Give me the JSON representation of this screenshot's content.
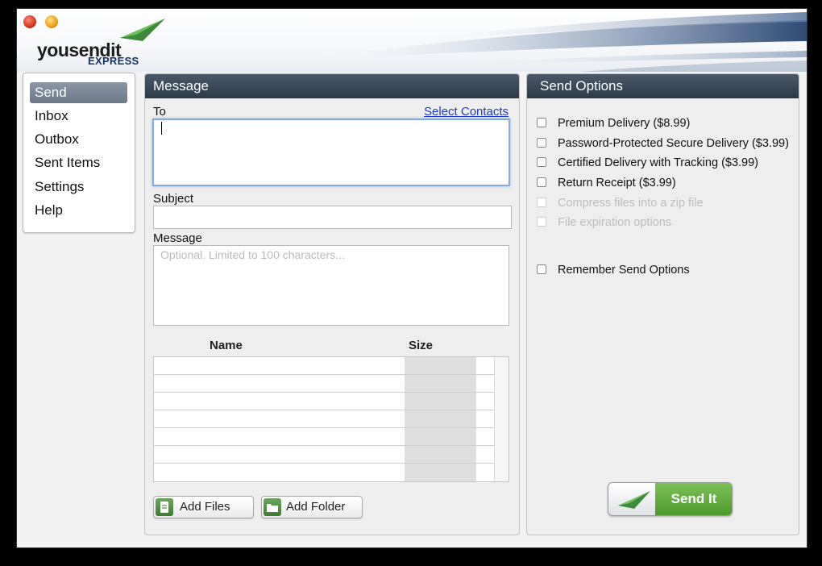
{
  "app": {
    "logo_main": "yousendit",
    "logo_sub": "EXPRESS"
  },
  "sidebar": {
    "items": [
      {
        "label": "Send",
        "active": true
      },
      {
        "label": "Inbox"
      },
      {
        "label": "Outbox"
      },
      {
        "label": "Sent Items"
      },
      {
        "label": "Settings"
      },
      {
        "label": "Help"
      }
    ]
  },
  "message": {
    "title": "Message",
    "to_label": "To",
    "select_contacts": "Select Contacts",
    "to_value": "",
    "subject_label": "Subject",
    "subject_value": "",
    "message_label": "Message",
    "message_placeholder": "Optional. Limited to 100 characters...",
    "table": {
      "columns": [
        "Name",
        "Size"
      ],
      "rows": []
    },
    "add_files": "Add Files",
    "add_folder": "Add Folder"
  },
  "options": {
    "title": "Send Options",
    "items": [
      {
        "label": "Premium Delivery ($8.99)",
        "checked": false,
        "enabled": true
      },
      {
        "label": "Password-Protected Secure Delivery ($3.99)",
        "checked": false,
        "enabled": true
      },
      {
        "label": "Certified Delivery with Tracking ($3.99)",
        "checked": false,
        "enabled": true
      },
      {
        "label": "Return Receipt ($3.99)",
        "checked": false,
        "enabled": true
      },
      {
        "label": "Compress files into a zip file",
        "checked": false,
        "enabled": false
      },
      {
        "label": "File expiration options",
        "checked": false,
        "enabled": false
      }
    ],
    "remember": "Remember Send Options",
    "send_button": "Send It"
  },
  "colors": {
    "panel_header": "#2c3a49",
    "send_green": "#4c9a2b",
    "link": "#1d3ad6",
    "focus_ring": "#86a9de"
  }
}
